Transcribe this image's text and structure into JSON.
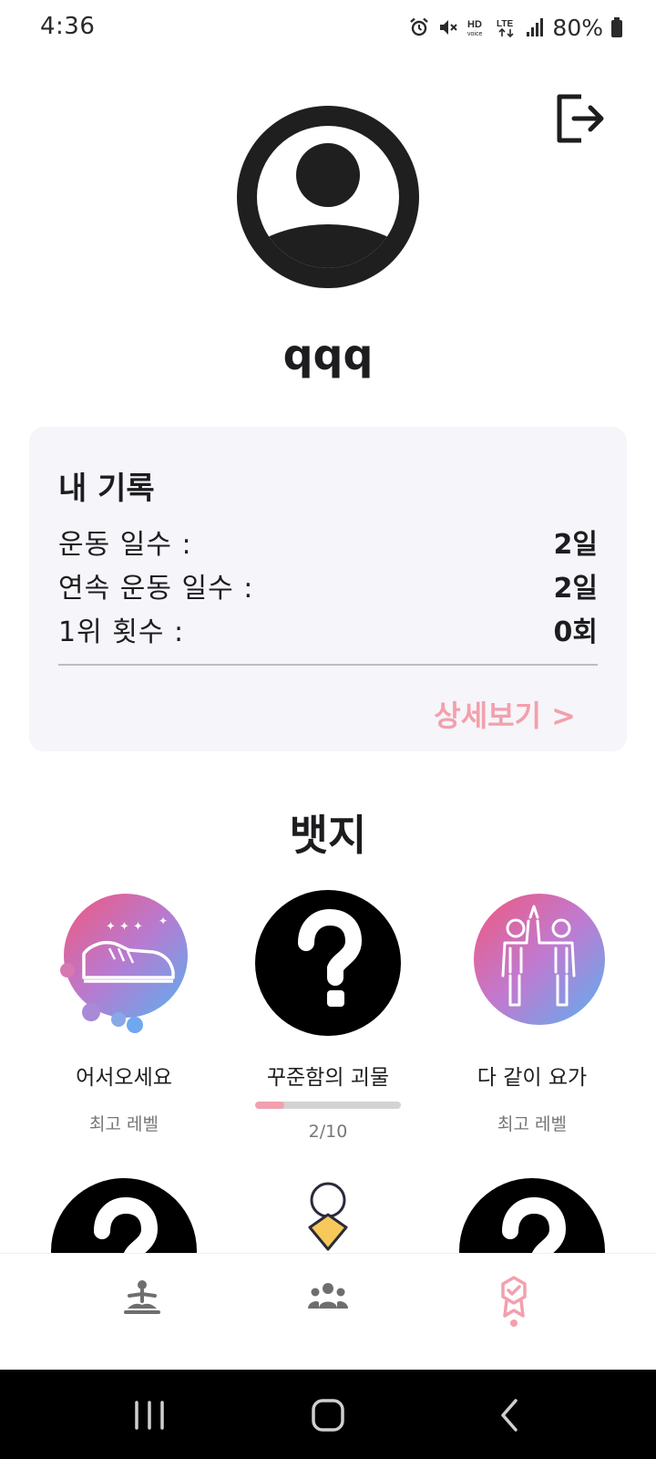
{
  "status_bar": {
    "time": "4:36",
    "battery": "80%",
    "icons": [
      "alarm-icon",
      "mute-icon",
      "hd-voice-icon",
      "lte-icon",
      "signal-icon",
      "battery-icon"
    ]
  },
  "header": {
    "logout_icon": "logout-icon",
    "avatar_icon": "account-circle-icon",
    "username": "qqq"
  },
  "record": {
    "title": "내 기록",
    "rows": [
      {
        "label": "운동 일수 :",
        "value": "2일"
      },
      {
        "label": "연속 운동 일수 :",
        "value": "2일"
      },
      {
        "label": "1위 횟수 :",
        "value": "0회"
      }
    ],
    "detail_link": "상세보기 >"
  },
  "badges": {
    "title": "뱃지",
    "items": [
      {
        "name": "어서오세요",
        "level": "최고 레벨",
        "icon": "sneaker-badge-icon"
      },
      {
        "name": "꾸준함의 괴물",
        "progress_text": "2/10",
        "progress": 0.2,
        "icon": "question-mark-icon"
      },
      {
        "name": "다 같이 요가",
        "level": "최고 레벨",
        "icon": "high-five-badge-icon"
      }
    ],
    "next_row_icons": [
      "question-mark-icon",
      "medal-icon",
      "question-mark-icon"
    ]
  },
  "bottom_nav": {
    "items": [
      "yoga-icon",
      "group-icon",
      "badge-icon"
    ],
    "active_index": 2
  },
  "colors": {
    "accent": "#f2a0ad",
    "card_bg": "#f6f5fa",
    "text": "#1d1d1f",
    "muted": "#777777",
    "nav_icon": "#6e6e6e"
  }
}
